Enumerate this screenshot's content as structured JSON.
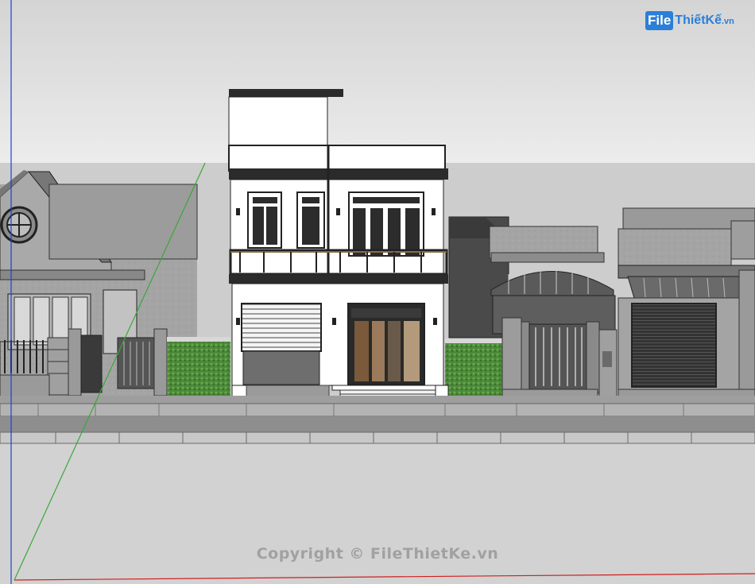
{
  "logo": {
    "brand_box": "File",
    "brand_rest": "ThiếtKế",
    "brand_suffix": ".vn"
  },
  "watermark": "Copyright © FileThietKe.vn",
  "colors": {
    "sky_top": "#d6d6d6",
    "sky_bottom": "#e9e9e9",
    "ground": "#c9c9c9",
    "facade_white": "#ffffff",
    "frame_dark": "#2b2b2b",
    "concrete_grey": "#9a9a9a",
    "hedge_green": "#4f8a3c",
    "axis_blue": "#1f3fd0",
    "axis_green": "#3aa83a",
    "axis_red": "#d01f1f"
  },
  "icons": [
    "round-window-icon"
  ]
}
